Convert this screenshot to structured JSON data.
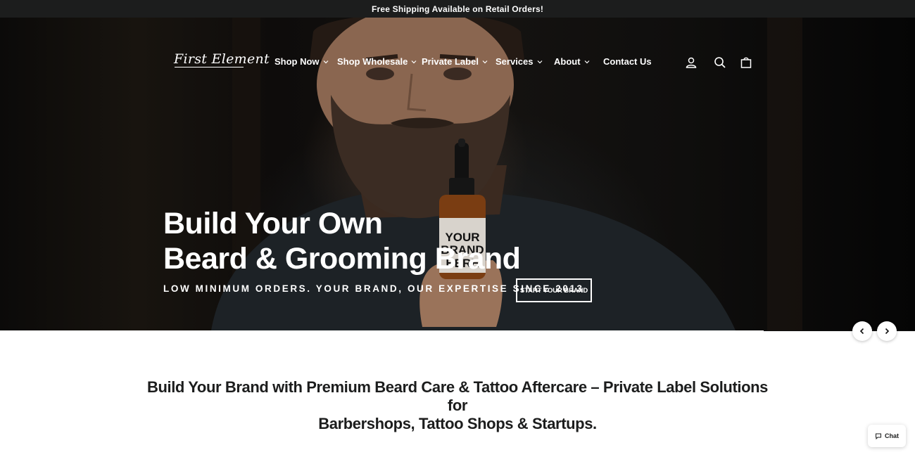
{
  "announcement": {
    "text": "Free Shipping Available on Retail Orders!"
  },
  "header": {
    "logo_text": "First Element",
    "nav": [
      {
        "label": "Shop Now",
        "has_dropdown": true
      },
      {
        "label": "Shop Wholesale",
        "has_dropdown": true
      },
      {
        "label": "Private Label",
        "has_dropdown": true
      },
      {
        "label": "Services",
        "has_dropdown": true
      },
      {
        "label": "About",
        "has_dropdown": true
      },
      {
        "label": "Contact Us",
        "has_dropdown": false
      }
    ],
    "icons": [
      "account-icon",
      "search-icon",
      "cart-icon"
    ]
  },
  "hero": {
    "headline_line1": "Build Your Own",
    "headline_line2": "Beard & Grooming Brand",
    "subline": "LOW MINIMUM ORDERS. YOUR BRAND, OUR EXPERTISE SINCE 2013",
    "cta_label": "START YOUR BRAND",
    "bottle_label": [
      "YOUR",
      "BRAND",
      "HERE"
    ]
  },
  "section": {
    "title_line1": "Build Your Brand with Premium Beard Care & Tattoo Aftercare – Private Label Solutions for",
    "title_line2": "Barbershops, Tattoo Shops & Startups."
  },
  "chat": {
    "label": "Chat"
  },
  "colors": {
    "announcement_bg": "#1c1d1d",
    "text_dark": "#1c1d1d",
    "white": "#ffffff"
  }
}
